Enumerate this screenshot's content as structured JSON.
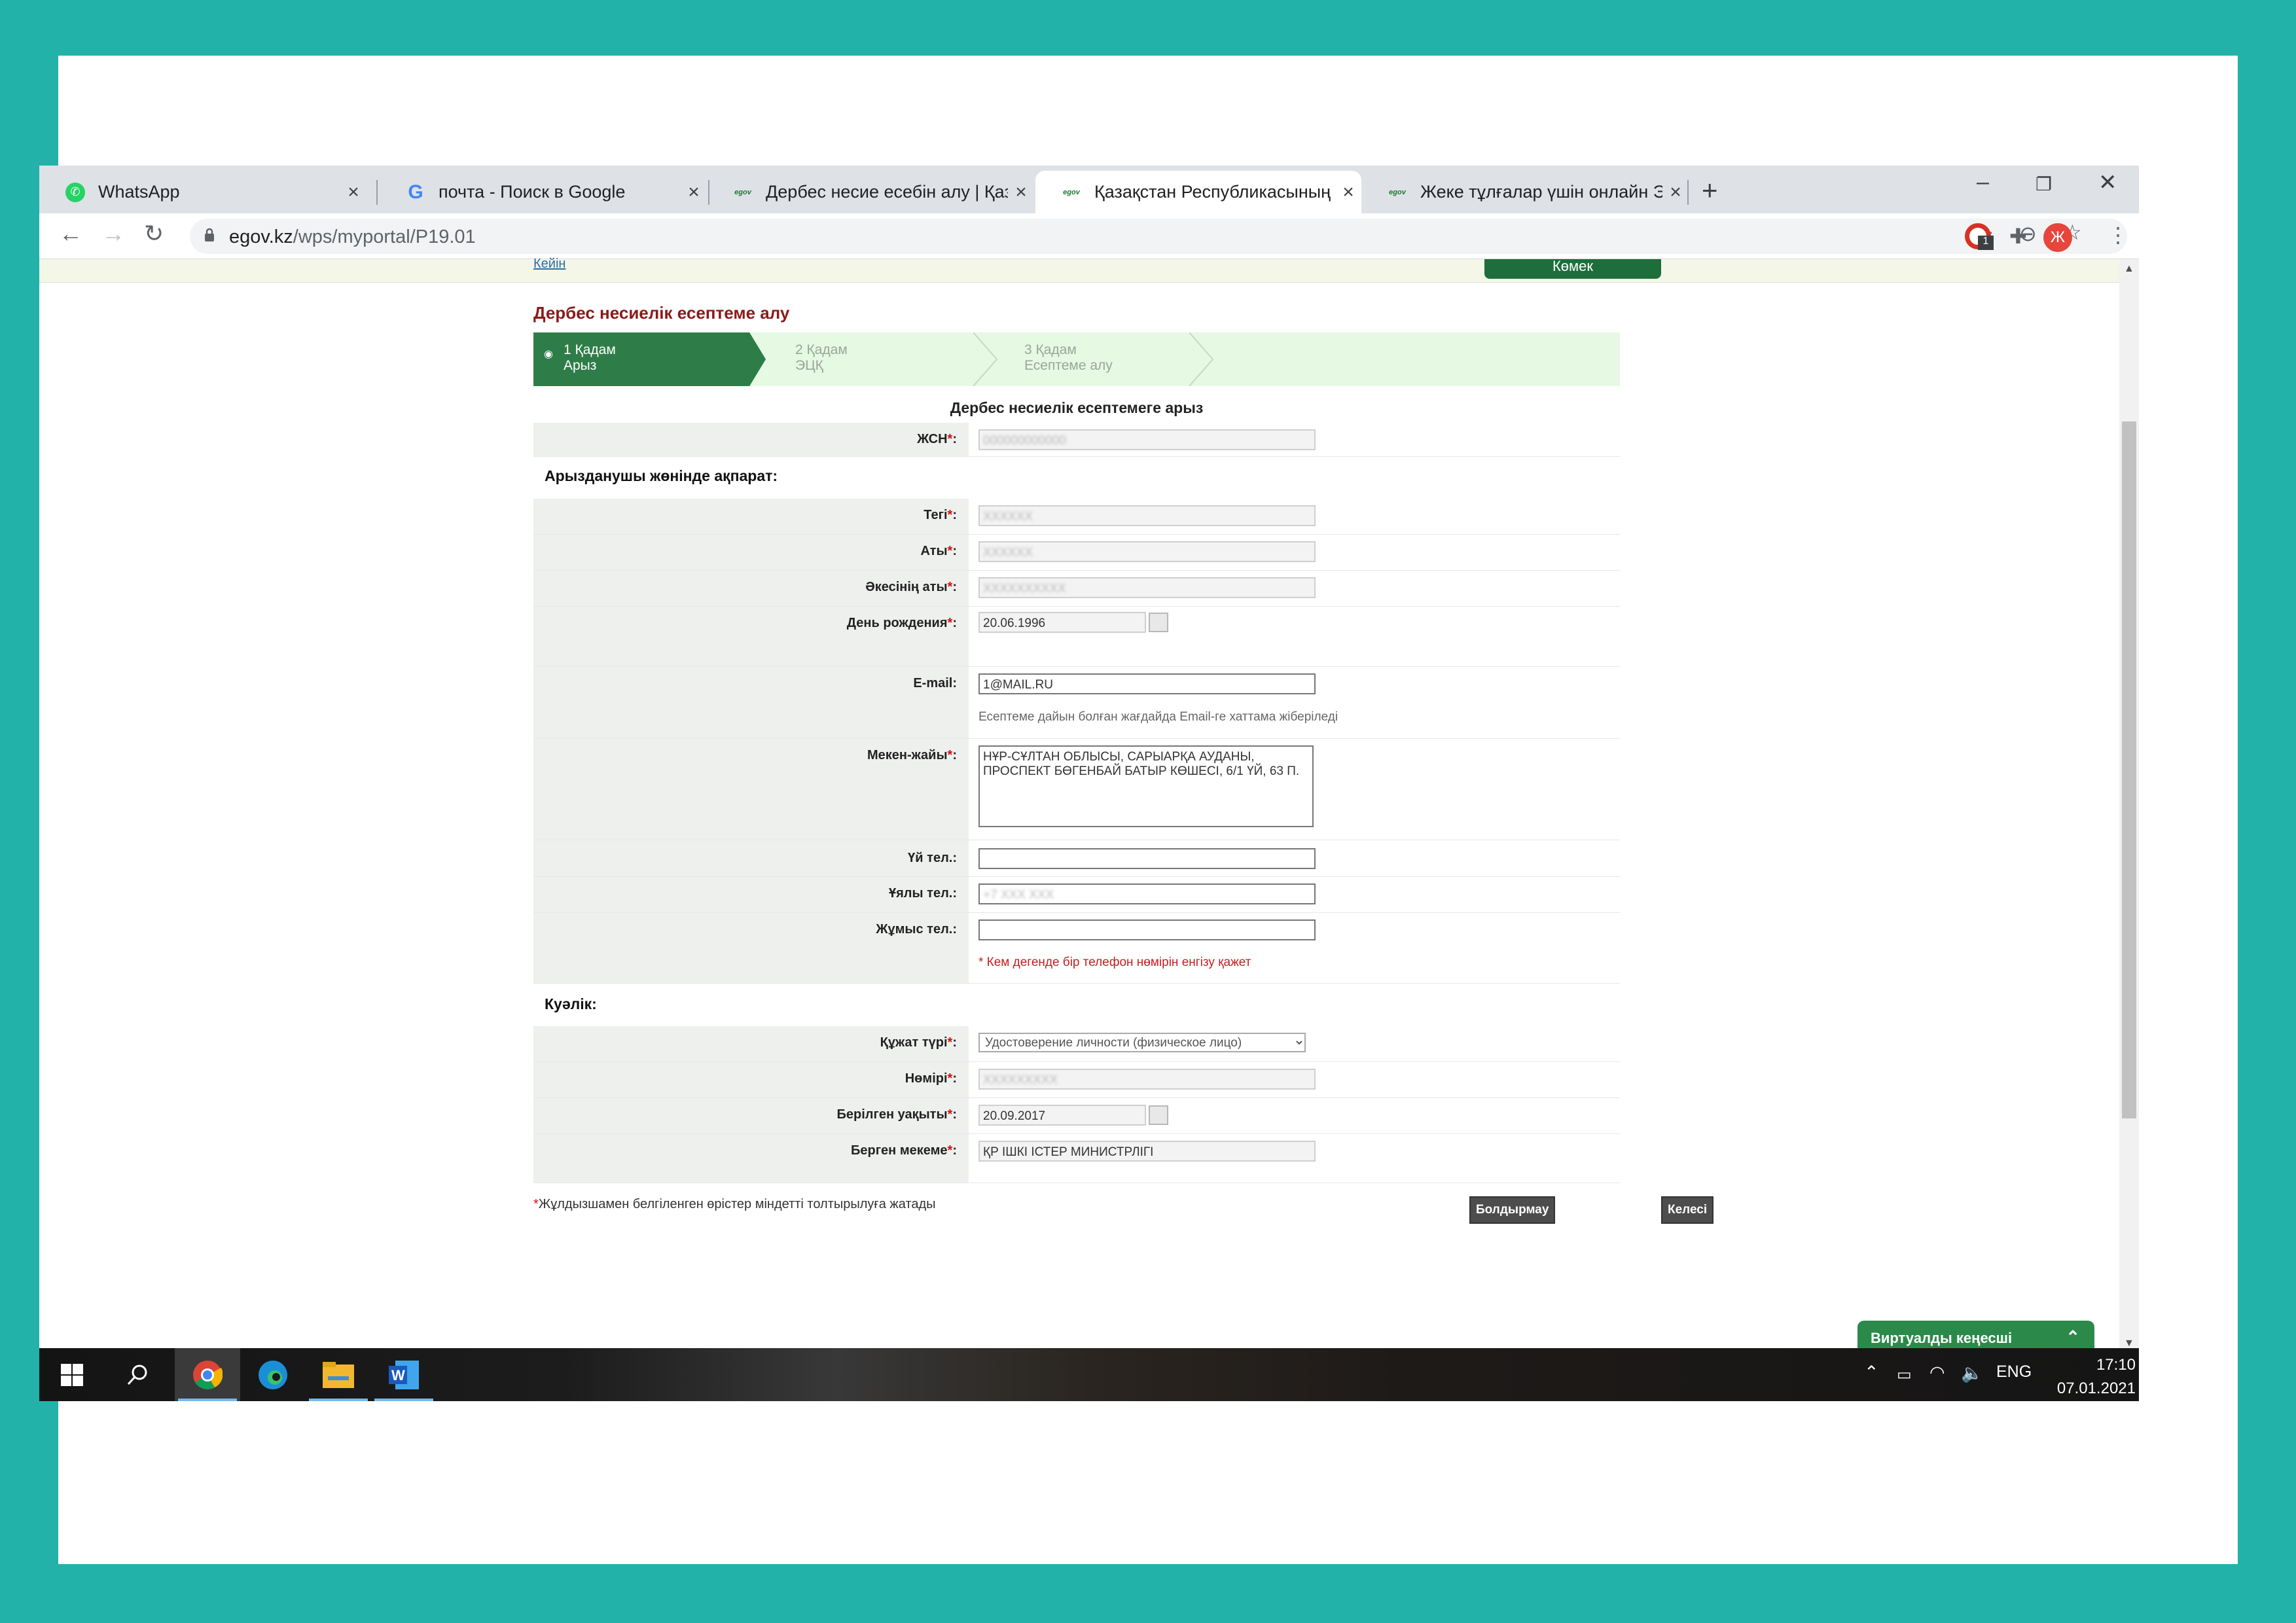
{
  "browser": {
    "tabs": [
      {
        "title": "WhatsApp",
        "icon": "whatsapp-icon"
      },
      {
        "title": "почта - Поиск в Google",
        "icon": "google-icon"
      },
      {
        "title": "Дербес несие есебін алу | Қазақ",
        "icon": "egov-icon"
      },
      {
        "title": "Қазақстан Республикасының Эл",
        "icon": "egov-icon"
      },
      {
        "title": "Жеке тұлғалар үшін онлайн ЭЦҚ",
        "icon": "egov-icon"
      }
    ],
    "favicon_text": "egov",
    "url_host": "egov.kz",
    "url_path": "/wps/myportal/P19.01",
    "avatar_letter": "Ж",
    "extension_badge": "1"
  },
  "page": {
    "top_link": "Кейін",
    "help_button": "Көмек",
    "title": "Дербес несиелік есептеме алу",
    "steps": [
      {
        "number": "1 Қадам",
        "label": "Арыз",
        "active": true
      },
      {
        "number": "2 Қадам",
        "label": "ЭЦҚ",
        "active": false
      },
      {
        "number": "3 Қадам",
        "label": "Есептеме алу",
        "active": false
      }
    ],
    "form_title": "Дербес несиелік есептемеге арыз",
    "iin_label": "ЖСН",
    "applicant_section": "Арызданушы жөнінде ақпарат:",
    "surname_label": "Тегі",
    "name_label": "Аты",
    "patronymic_label": "Әкесінің аты",
    "birthdate_label": "День рождения",
    "birthdate_value": "20.06.1996",
    "email_label": "E-mail:",
    "email_value": "1@MAIL.RU",
    "email_hint": "Есептеме дайын болған жағдайда Email-ге хаттама жіберіледі",
    "address_label": "Мекен-жайы",
    "address_value": "НҰР-СҰЛТАН ОБЛЫСЫ, САРЫАРҚА АУДАНЫ, ПРОСПЕКТ БӨГЕНБАЙ БАТЫР КӨШЕСІ, 6/1 ҮЙ, 63 П.",
    "home_phone_label": "Үй тел.:",
    "mobile_phone_label": "Ұялы тел.:",
    "work_phone_label": "Жұмыс тел.:",
    "phone_hint": "* Кем дегенде бір телефон нөмірін енгізу қажет",
    "id_section": "Куәлік:",
    "doc_type_label": "Құжат түрі",
    "doc_type_value": "Удостоверение личности (физическое лицо)",
    "doc_number_label": "Нөмірі",
    "issue_date_label": "Берілген уақыты",
    "issue_date_value": "20.09.2017",
    "issuer_label": "Берген мекеме",
    "issuer_value": "ҚР ІШКІ ІСТЕР МИНИСТРЛІГІ",
    "required_note": "Жұлдызшамен белгіленген өрістер міндетті толтырылуға жатады",
    "cancel_button": "Болдырмау",
    "next_button": "Келесі",
    "virtual_consultant": "Виртуалды кеңесші"
  },
  "taskbar": {
    "language": "ENG",
    "time": "17:10",
    "date": "07.01.2021"
  },
  "colors": {
    "accent_green": "#2e7d48",
    "title_red": "#8b1a1a",
    "background_teal": "#22b2aa"
  }
}
